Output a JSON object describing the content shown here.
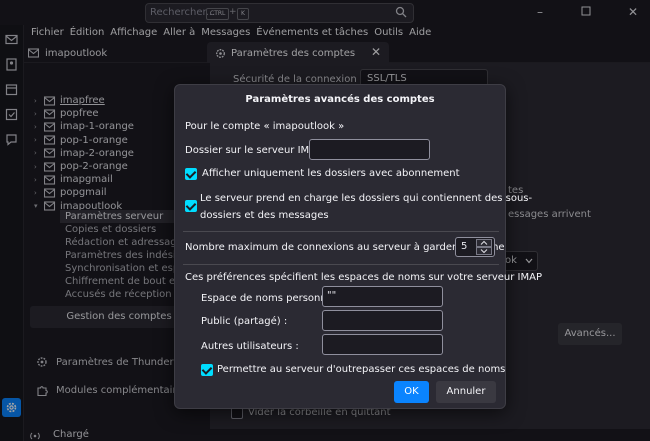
{
  "titlebar": {
    "search_placeholder": "Rechercher...",
    "shortcut_ctrl": "CTRL",
    "shortcut_plus": "+",
    "shortcut_key": "K"
  },
  "menubar": [
    "Fichier",
    "Édition",
    "Affichage",
    "Aller à",
    "Messages",
    "Événements et tâches",
    "Outils",
    "Aide"
  ],
  "tabs": {
    "tab1_label": "imapoutlook",
    "tab2_label": "Paramètres des comptes"
  },
  "accounts": [
    {
      "label": "imapfree",
      "expanded": false
    },
    {
      "label": "popfree",
      "expanded": false
    },
    {
      "label": "imap-1-orange",
      "expanded": false
    },
    {
      "label": "pop-1-orange",
      "expanded": false
    },
    {
      "label": "imap-2-orange",
      "expanded": false
    },
    {
      "label": "pop-2-orange",
      "expanded": false
    },
    {
      "label": "imapgmail",
      "expanded": false
    },
    {
      "label": "popgmail",
      "expanded": false
    },
    {
      "label": "imapoutlook",
      "expanded": true
    }
  ],
  "subitems": [
    "Paramètres serveur",
    "Copies et dossiers",
    "Rédaction et adressage",
    "Paramètres des indésirab",
    "Synchronisation et espace",
    "Chiffrement de bout en bo",
    "Accusés de réception"
  ],
  "sidebar_buttons": {
    "gestion": "Gestion des comptes",
    "thunderbird_settings": "Paramètres de Thunderbird",
    "addons": "Modules complémentaires et t"
  },
  "background": {
    "security_label": "Sécurité de la connexion :",
    "security_value": "SSL/TLS",
    "partial_1": "tes",
    "partial_2": "essages arrivent",
    "partial_3": "ok",
    "advanced_button": "Avancés...",
    "empty_trash": "Vider la corbeille en quittant"
  },
  "status": {
    "text": "Chargé"
  },
  "dialog": {
    "title": "Paramètres avancés des comptes",
    "for_account": "Pour le compte « imapoutlook »",
    "imap_folder_label": "Dossier sur le serveur IMAP :",
    "imap_folder_value": "",
    "cb1_label": "Afficher uniquement les dossiers avec abonnement",
    "cb2_label_line1": "Le serveur prend en charge les dossiers qui contiennent des sous-",
    "cb2_label_line2": "dossiers et des messages",
    "max_conn_label": "Nombre maximum de connexions au serveur à garder en cache",
    "max_conn_value": "5",
    "namespace_intro": "Ces préférences spécifient les espaces de noms sur votre serveur IMAP",
    "personal_label": "Espace de noms personnel :",
    "personal_value": "\"\"",
    "public_label": "Public (partagé) :",
    "public_value": "",
    "others_label": "Autres utilisateurs :",
    "others_value": "",
    "cb3_label": "Permettre au serveur d'outrepasser ces espaces de noms",
    "ok": "OK",
    "cancel": "Annuler"
  },
  "colors": {
    "accent": "#00ddff",
    "ok_button": "#0a84ff"
  }
}
